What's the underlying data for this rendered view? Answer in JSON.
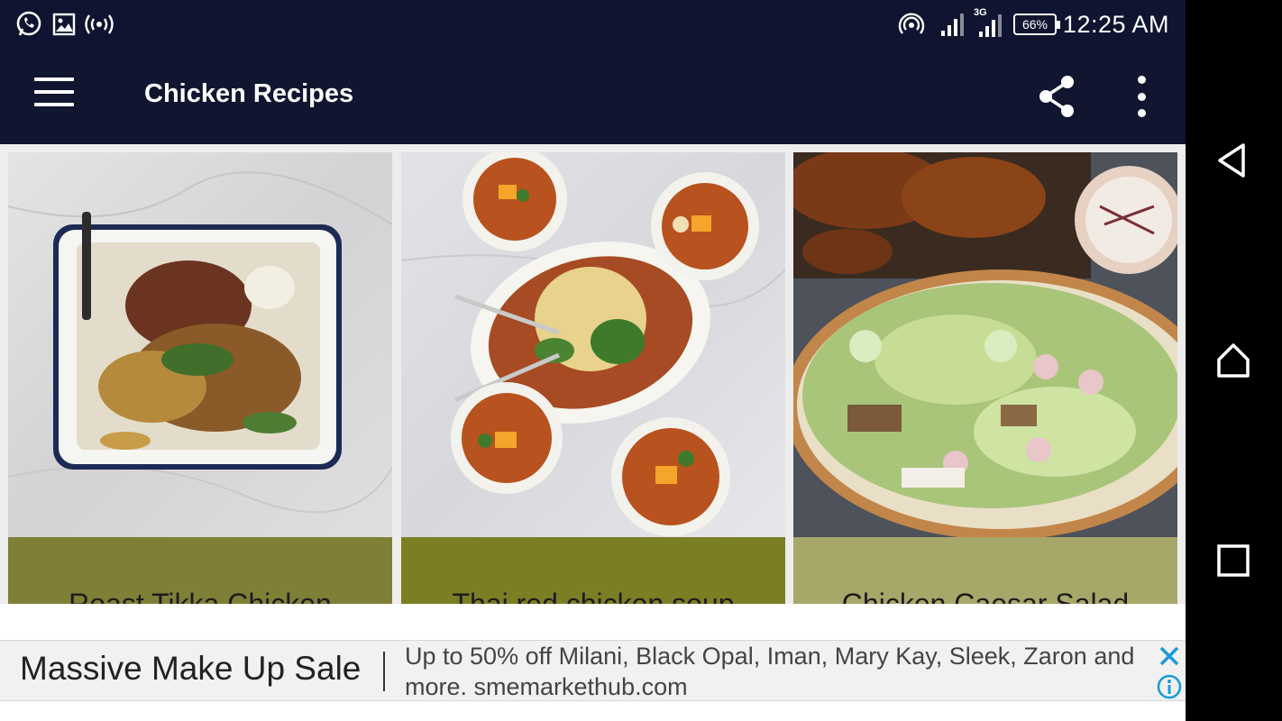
{
  "status_bar": {
    "time": "12:25 AM",
    "battery": "66%",
    "network": "3G",
    "icons": [
      "whatsapp-icon",
      "image-icon",
      "wireless-icon",
      "hotspot-icon",
      "signal-icon",
      "signal-3g-icon",
      "battery-icon"
    ]
  },
  "app_bar": {
    "title": "Chicken Recipes",
    "icons": [
      "menu-icon",
      "share-icon",
      "more-vert-icon"
    ]
  },
  "recipes": [
    {
      "title": "Roast Tikka Chicken",
      "footer_color": "#7f8036"
    },
    {
      "title": "Thai red chicken soup",
      "footer_color": "#7c7e23"
    },
    {
      "title": "Chicken Caesar Salad",
      "footer_color": "#a6a769"
    }
  ],
  "ad": {
    "headline": "Massive Make Up Sale",
    "body": "Up to 50% off Milani, Black Opal, Iman, Mary Kay, Sleek, Zaron and more. smemarkethub.com",
    "accent_color": "#1a9bd7",
    "icons": [
      "close-icon",
      "info-icon"
    ]
  },
  "nav_bar": {
    "icons": [
      "back-icon",
      "home-icon",
      "recents-icon"
    ]
  },
  "colors": {
    "status_bar": "#0f1530",
    "app_bar": "#101630"
  }
}
